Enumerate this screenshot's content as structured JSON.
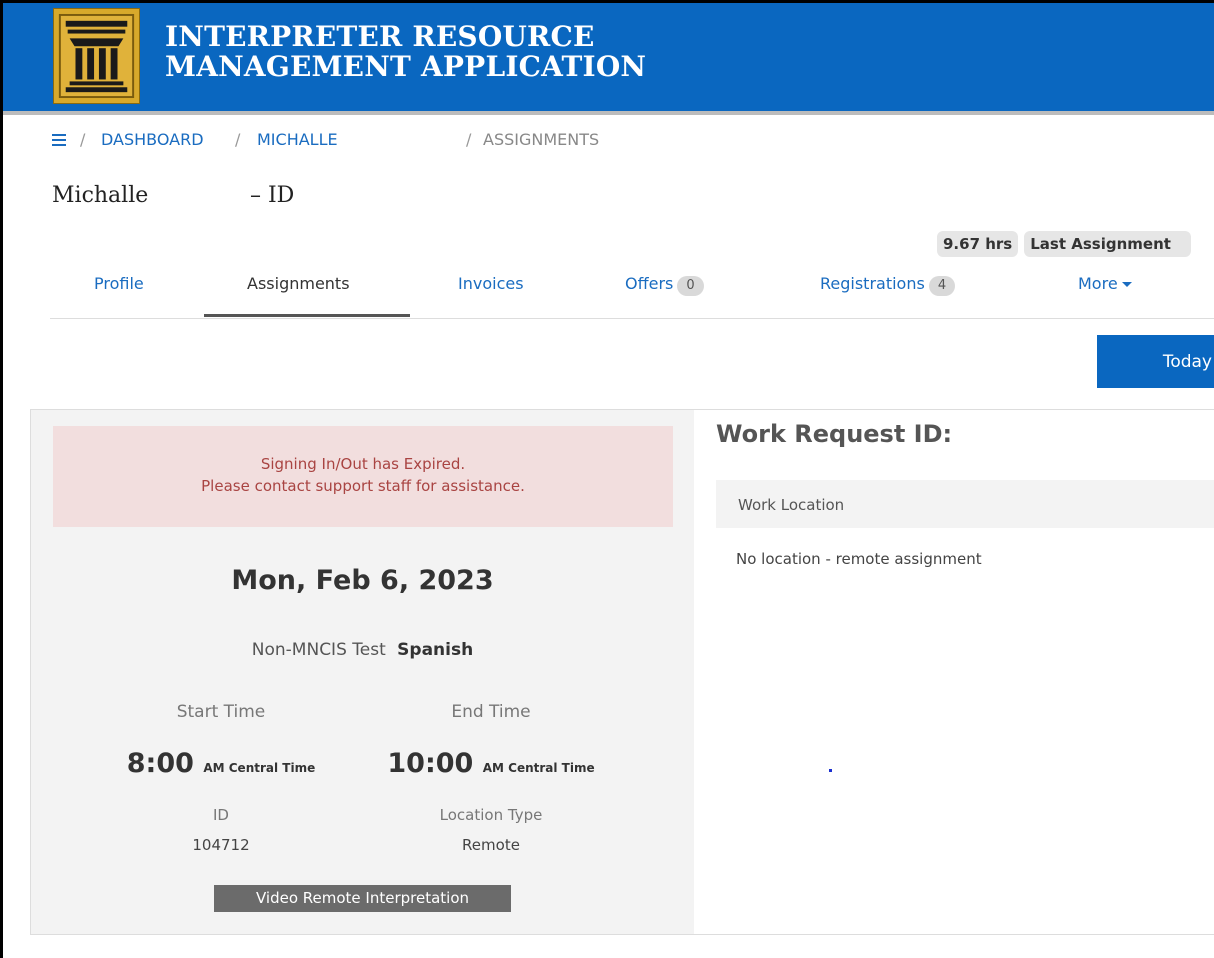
{
  "header": {
    "title_line1": "INTERPRETER RESOURCE",
    "title_line2": "MANAGEMENT APPLICATION",
    "brand_color": "#0a67c0",
    "logo_icon": "courthouse-pillar-logo"
  },
  "breadcrumb": {
    "menu_icon": "hamburger-icon",
    "items": [
      "DASHBOARD",
      "MICHALLE",
      "ASSIGNMENTS"
    ]
  },
  "person": {
    "first_name": "Michalle",
    "id_label": "– ID"
  },
  "stats": {
    "hours": "9.67 hrs",
    "last_assignment": "Last Assignment"
  },
  "tabs": [
    {
      "label": "Profile"
    },
    {
      "label": "Assignments",
      "active": true
    },
    {
      "label": "Invoices"
    },
    {
      "label": "Offers",
      "count": "0"
    },
    {
      "label": "Registrations",
      "count": "4"
    },
    {
      "label": "More",
      "icon": "caret-down-icon"
    }
  ],
  "toolbar": {
    "today_label": "Today"
  },
  "assignment": {
    "alert_line1": "Signing In/Out has Expired.",
    "alert_line2": "Please contact support staff for assistance.",
    "date": "Mon, Feb 6, 2023",
    "case_type": "Non-MNCIS Test",
    "language": "Spanish",
    "start_label": "Start Time",
    "end_label": "End Time",
    "start_time": "8:00",
    "end_time": "10:00",
    "time_suffix": "AM Central Time",
    "id_label": "ID",
    "id_value": "104712",
    "location_type_label": "Location Type",
    "location_type_value": "Remote",
    "mode_badge": "Video Remote Interpretation"
  },
  "work_request": {
    "title": "Work Request ID:",
    "location_header": "Work Location",
    "location_text": "No location - remote assignment"
  }
}
